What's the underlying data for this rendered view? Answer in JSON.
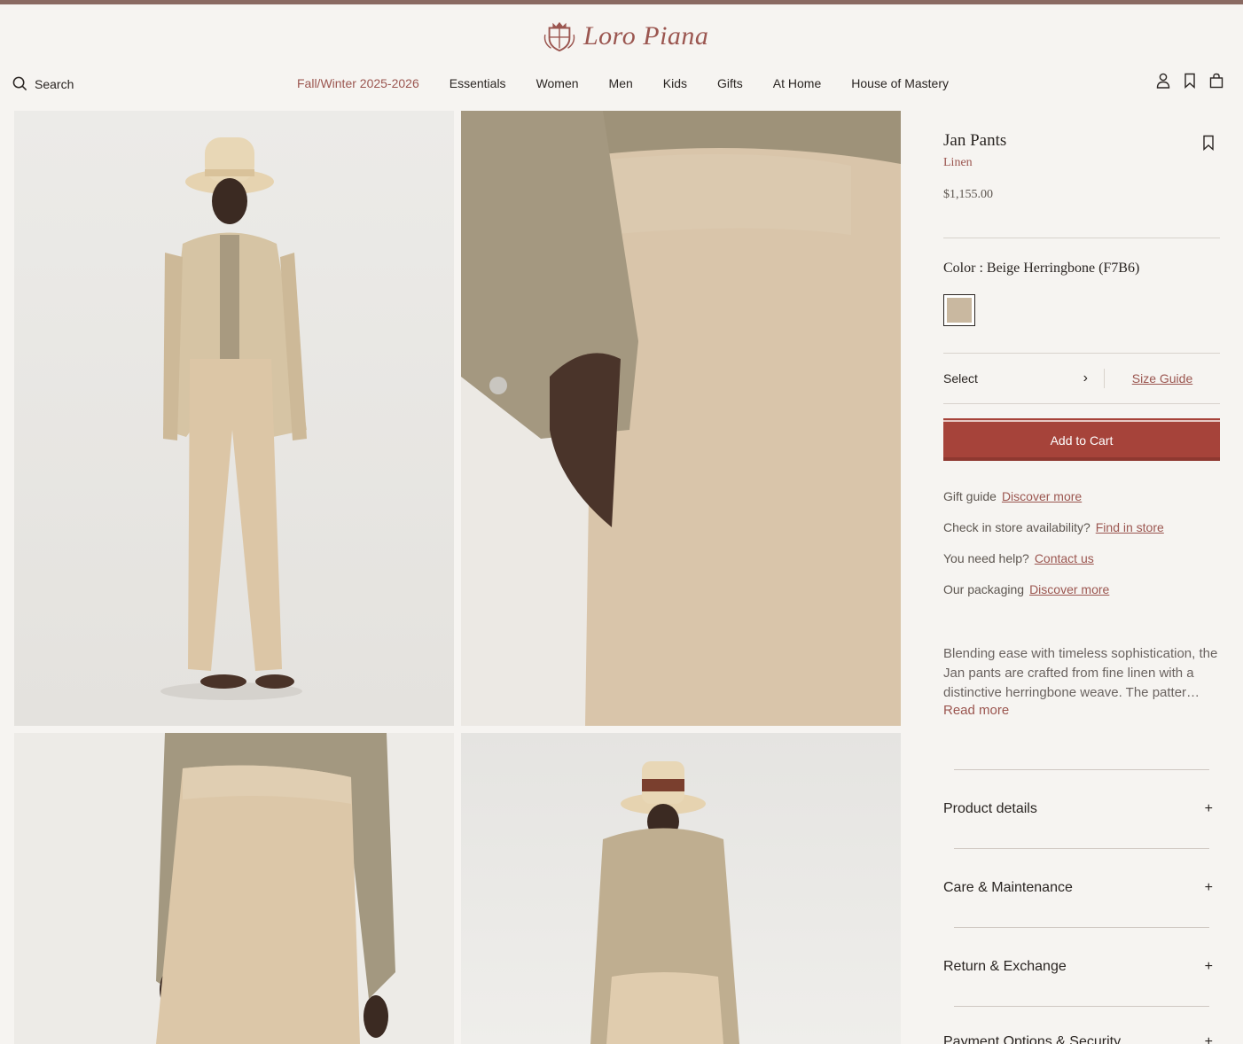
{
  "brand": {
    "name": "Loro Piana"
  },
  "header": {
    "search_label": "Search",
    "nav": [
      "Fall/Winter 2025-2026",
      "Essentials",
      "Women",
      "Men",
      "Kids",
      "Gifts",
      "At Home",
      "House of Mastery"
    ]
  },
  "product": {
    "title": "Jan Pants",
    "material": "Linen",
    "price": "$1,155.00",
    "color_label": "Color : Beige Herringbone (F7B6)",
    "select_label": "Select",
    "size_guide": "Size Guide",
    "add_to_cart": "Add to Cart",
    "info": [
      {
        "label": "Gift guide",
        "link": "Discover more"
      },
      {
        "label": "Check in store availability?",
        "link": "Find in store"
      },
      {
        "label": "You need help?",
        "link": "Contact us"
      },
      {
        "label": "Our packaging",
        "link": "Discover more"
      }
    ],
    "description": "Blending ease with timeless sophistication, the Jan pants are crafted from fine linen with a distinctive herringbone weave. The patter…",
    "read_more": "Read more",
    "accordions": [
      "Product details",
      "Care & Maintenance",
      "Return & Exchange",
      "Payment Options & Security"
    ]
  },
  "colors": {
    "accent": "#9b5650",
    "button": "#a6433a",
    "swatch": "#c9b8a0"
  }
}
